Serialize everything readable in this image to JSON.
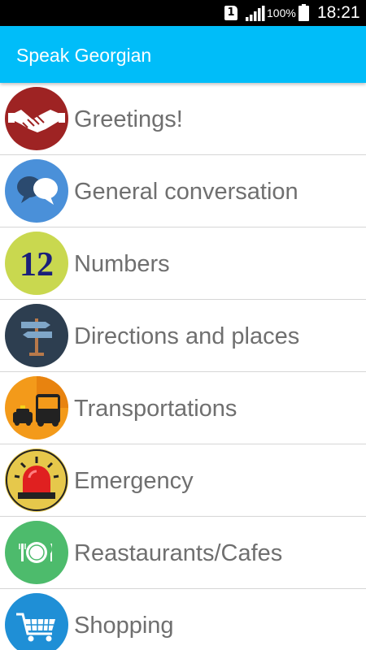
{
  "status_bar": {
    "sim_slot": "1",
    "battery_percent": "100%",
    "time": "18:21"
  },
  "app_bar": {
    "title": "Speak Georgian"
  },
  "categories": [
    {
      "label": "Greetings!",
      "icon": "handshake-icon",
      "color": "#9e2323"
    },
    {
      "label": "General conversation",
      "icon": "speech-bubbles-icon",
      "color": "#4a90d9"
    },
    {
      "label": "Numbers",
      "icon": "number-12-icon",
      "color": "#c9d84f",
      "icon_text": "12"
    },
    {
      "label": "Directions and places",
      "icon": "signpost-icon",
      "color": "#2d3e50"
    },
    {
      "label": "Transportations",
      "icon": "taxi-bus-icon",
      "color": "#f39a1a"
    },
    {
      "label": "Emergency",
      "icon": "siren-icon",
      "color": "#e6c84b"
    },
    {
      "label": "Reastaurants/Cafes",
      "icon": "plate-cutlery-icon",
      "color": "#4dbb6c"
    },
    {
      "label": "Shopping",
      "icon": "shopping-cart-icon",
      "color": "#1f8fd6"
    }
  ]
}
